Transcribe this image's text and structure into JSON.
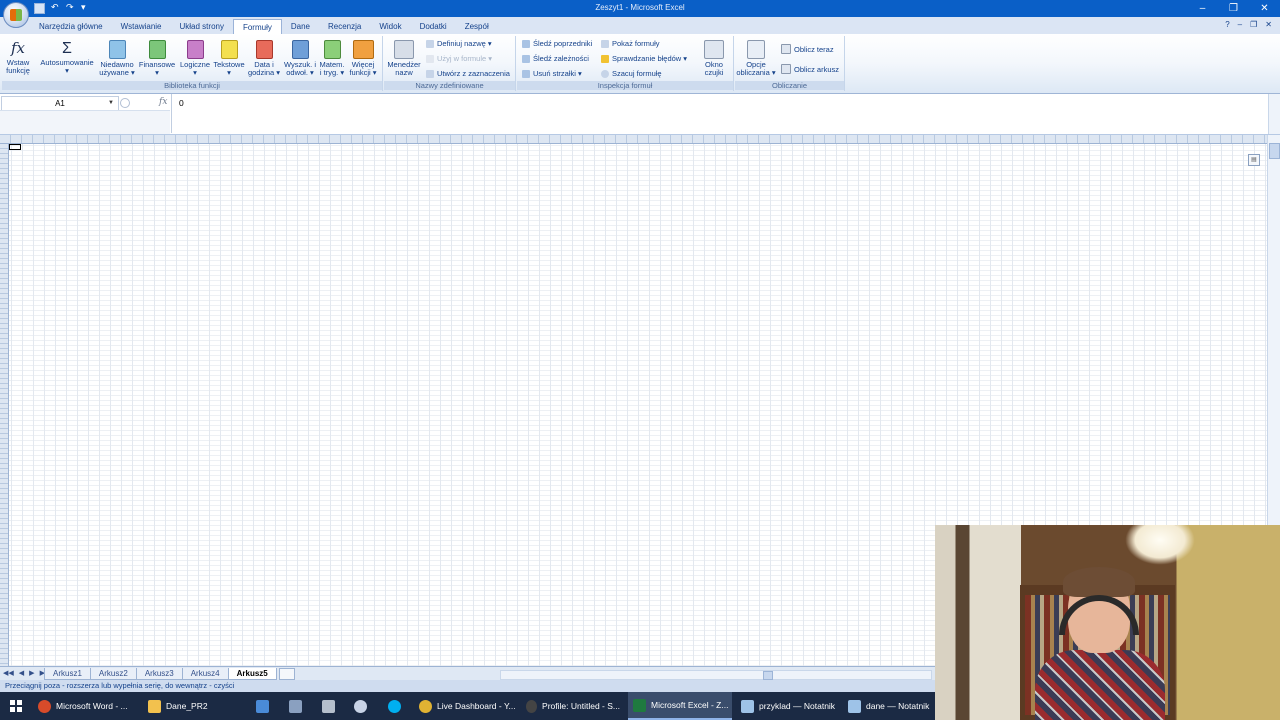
{
  "window": {
    "title": "Zeszyt1 - Microsoft Excel"
  },
  "tabs": [
    "Narzędzia główne",
    "Wstawianie",
    "Układ strony",
    "Formuły",
    "Dane",
    "Recenzja",
    "Widok",
    "Dodatki",
    "Zespół"
  ],
  "active_tab": "Formuły",
  "ribbon": {
    "biblioteka": {
      "label": "Biblioteka funkcji",
      "wstaw_funkcje": "Wstaw\nfunkcję",
      "autosumowanie": "Autosumowanie\n▾",
      "niedawno": "Niedawno\nużywane ▾",
      "finansowe": "Finansowe\n▾",
      "logiczne": "Logiczne\n▾",
      "tekstowe": "Tekstowe\n▾",
      "data": "Data i\ngodzina ▾",
      "wyszuk": "Wyszuk. i\nodwoł. ▾",
      "matem": "Matem.\ni tryg. ▾",
      "wiecej": "Więcej\nfunkcji ▾"
    },
    "nazwy": {
      "label": "Nazwy zdefiniowane",
      "menedzer": "Menedżer\nnazw",
      "definiuj": "Definiuj nazwę ▾",
      "uzyj": "Użyj w formule ▾",
      "utworz": "Utwórz z zaznaczenia"
    },
    "inspekcja": {
      "label": "Inspekcja formuł",
      "sledz_poprzedniki": "Śledź poprzedniki",
      "sledz_zaleznosci": "Śledź zależności",
      "usun_strzalki": "Usuń strzałki ▾",
      "pokaz_formuly": "Pokaż formuły",
      "sprawdzanie": "Sprawdzanie błędów ▾",
      "szacuj": "Szacuj formułę",
      "okno": "Okno\nczujki"
    },
    "obliczanie": {
      "label": "Obliczanie",
      "opcje": "Opcje\nobliczania ▾",
      "oblicz_teraz": "Oblicz teraz",
      "oblicz_arkusz": "Oblicz arkusz"
    }
  },
  "formula_bar": {
    "name_box": "A1",
    "value": "0",
    "fx": "fx"
  },
  "sheets": [
    "Arkusz1",
    "Arkusz2",
    "Arkusz3",
    "Arkusz4",
    "Arkusz5"
  ],
  "active_sheet": "Arkusz5",
  "status_text": "Przeciągnij poza - rozszerza lub wypełnia serię, do wewnątrz - czyści",
  "taskbar": {
    "items": [
      {
        "label": "Microsoft Word - ...",
        "icon": "chrome-icon",
        "color": "#d74b2a"
      },
      {
        "label": "Dane_PR2",
        "icon": "folder-icon",
        "color": "#f2c14e"
      },
      {
        "label": "",
        "icon": "app-icon",
        "color": "#4a8bd8"
      },
      {
        "label": "",
        "icon": "calculator-icon",
        "color": "#8aa0c0"
      },
      {
        "label": "",
        "icon": "calculator2-icon",
        "color": "#b5bfcc"
      },
      {
        "label": "",
        "icon": "steam-icon",
        "color": "#c8d3e6"
      },
      {
        "label": "",
        "icon": "skype-icon",
        "color": "#00aff0"
      },
      {
        "label": "Live Dashboard - Y...",
        "icon": "chrome-icon",
        "color": "#e0b233"
      },
      {
        "label": "Profile: Untitled - S...",
        "icon": "obs-icon",
        "color": "#444"
      },
      {
        "label": "Microsoft Excel - Z...",
        "icon": "excel-icon",
        "color": "#1f7a3f"
      },
      {
        "label": "przyklad — Notatnik",
        "icon": "notepad-icon",
        "color": "#9ec3e8"
      },
      {
        "label": "dane — Notatnik",
        "icon": "notepad-icon",
        "color": "#9ec3e8"
      }
    ]
  }
}
